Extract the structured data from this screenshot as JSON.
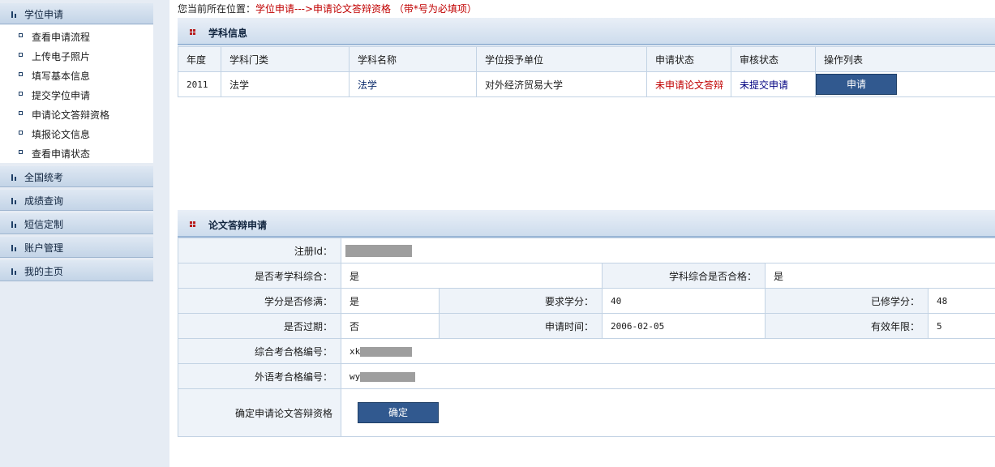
{
  "sidebar": {
    "sections": [
      {
        "label": "学位申请"
      },
      {
        "label": "全国统考"
      },
      {
        "label": "成绩查询"
      },
      {
        "label": "短信定制"
      },
      {
        "label": "账户管理"
      },
      {
        "label": "我的主页"
      }
    ],
    "submenu": [
      {
        "label": "查看申请流程"
      },
      {
        "label": "上传电子照片"
      },
      {
        "label": "填写基本信息"
      },
      {
        "label": "提交学位申请"
      },
      {
        "label": "申请论文答辩资格"
      },
      {
        "label": "填报论文信息"
      },
      {
        "label": "查看申请状态"
      }
    ]
  },
  "location": {
    "prefix": "您当前所在位置：",
    "path": "学位申请--->申请论文答辩资格 （带*号为必填项）"
  },
  "subject_panel": {
    "title": "学科信息",
    "columns": [
      "年度",
      "学科门类",
      "学科名称",
      "学位授予单位",
      "申请状态",
      "审核状态",
      "操作列表"
    ],
    "row": {
      "year": "2011",
      "category": "法学",
      "name": "法学",
      "unit": "对外经济贸易大学",
      "apply_status": "未申请论文答辩",
      "review_status": "未提交申请",
      "action_label": "申请"
    },
    "colors": {
      "apply_status": "#c00000",
      "review_status": "#000080",
      "name": "#0a2a6a"
    }
  },
  "defense_panel": {
    "title": "论文答辩申请",
    "register_id_label": "注册Id：",
    "take_exam_label": "是否考学科综合：",
    "take_exam_value": "是",
    "exam_pass_label": "学科综合是否合格：",
    "exam_pass_value": "是",
    "credit_full_label": "学分是否修满：",
    "credit_full_value": "是",
    "credit_required_label": "要求学分：",
    "credit_required_value": "40",
    "credit_earned_label": "已修学分：",
    "credit_earned_value": "48",
    "expired_label": "是否过期：",
    "expired_value": "否",
    "apply_time_label": "申请时间：",
    "apply_time_value": "2006-02-05",
    "valid_years_label": "有效年限：",
    "valid_years_value": "5",
    "exam_cert_label": "综合考合格编号：",
    "exam_cert_prefix": "xk",
    "lang_cert_label": "外语考合格编号：",
    "lang_cert_prefix": "wy",
    "confirm_label": "确定申请论文答辩资格",
    "confirm_button": "确定"
  }
}
